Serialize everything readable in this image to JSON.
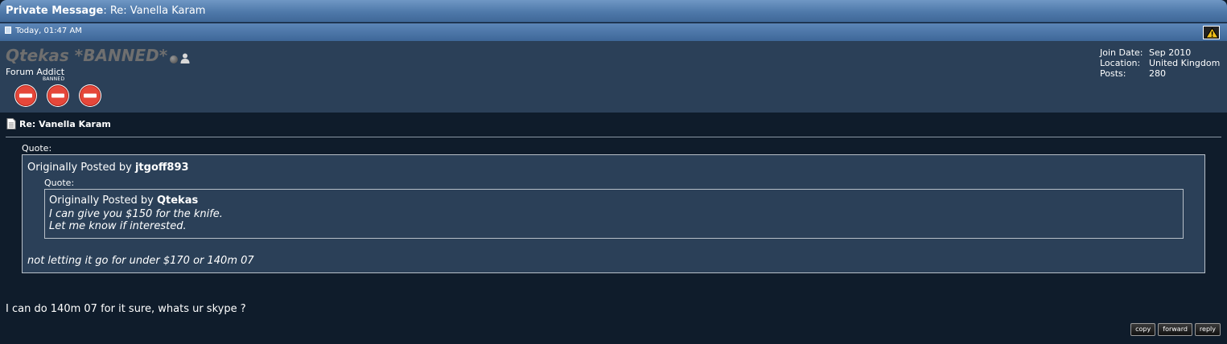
{
  "window": {
    "title_lead": "Private Message",
    "title_rest": ": Re: Vanella Karam"
  },
  "message": {
    "date": "Today, 01:47 AM",
    "subject": "Re: Vanella Karam",
    "body": "I can do 140m 07 for it sure, whats ur skype ?"
  },
  "user": {
    "name": "Qtekas *BANNED*",
    "title": "Forum Addict",
    "badge_caption": "BANNED",
    "status": "offline",
    "info": [
      {
        "label": "Join Date:",
        "value": "Sep 2010"
      },
      {
        "label": "Location:",
        "value": "United Kingdom"
      },
      {
        "label": "Posts:",
        "value": "280"
      }
    ]
  },
  "quote_outer": {
    "label": "Quote:",
    "prefix": "Originally Posted by ",
    "author": "jtgoff893",
    "reply": "not letting it go for under $170 or 140m 07"
  },
  "quote_inner": {
    "label": "Quote:",
    "prefix": "Originally Posted by ",
    "author": "Qtekas",
    "line1": "I can give you $150 for the knife.",
    "line2": "Let me know if interested."
  },
  "actions": {
    "copy": "copy",
    "forward": "forward",
    "reply": "reply"
  },
  "icons": {
    "badge": "no-entry-icon",
    "warn": "warning-triangle-icon",
    "status": "offline-dot-icon",
    "profile": "person-icon",
    "page": "page-icon"
  },
  "colors": {
    "title_bar": "#4f79aa",
    "user_panel": "#2b4058",
    "background": "#0f1c2b",
    "badge_red": "#e5473a",
    "username_gray": "#6f6f6f"
  }
}
